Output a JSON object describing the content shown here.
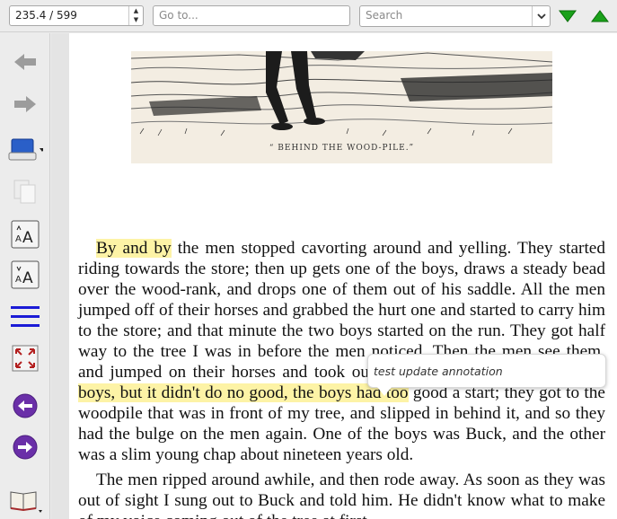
{
  "toolbar": {
    "page_position": "235.4 / 599",
    "goto_placeholder": "Go to...",
    "search_placeholder": "Search",
    "next_icon": "triangle-down-green-icon",
    "prev_icon": "triangle-up-green-icon"
  },
  "sidebar": {
    "icons": [
      "back-arrow-icon",
      "forward-arrow-icon",
      "view-mode-icon",
      "copy-icon",
      "font-larger-icon",
      "font-smaller-icon",
      "toc-lines-icon",
      "fullscreen-icon",
      "previous-page-icon",
      "next-page-icon",
      "library-book-icon"
    ]
  },
  "document": {
    "caption": "“ BEHIND THE WOOD-PILE.”",
    "p1_hl1": "By and by",
    "p1_a": " the men stopped cavorting around and yelling.  They started riding towards the store; then up gets one of the boys, draws a steady bead over the wood-rank, and drops one of them out of his saddle.  All the men jumped off of their horses and grabbed the hurt one and started to carry him to the store; and that minute the two boys started on the run.  They got half way to the tree I was in before the men noticed.  Then the men see them, and jumped on their horses and took out after them.  They gained on ",
    "p1_hl2": "the boys, but it didn't do no good, the boys had too",
    "p1_b": " good a start; they got to the woodpile that was in front of my tree, and slipped in behind it, and so they had the bulge on the men again.  One of the boys was Buck, and the other was a slim young chap about nineteen years old.",
    "p2": "The men ripped around awhile, and then rode away.  As soon as they was out of sight I sung out to Buck and told him.  He didn't know what to make of my voice coming out of the tree at first."
  },
  "annotation": {
    "text": "test update annotation"
  },
  "colors": {
    "highlight": "#fdf3a6",
    "nav_green": "#1aa11a",
    "icon_blue": "#1a1ad6",
    "icon_purple": "#6a2fa8"
  }
}
